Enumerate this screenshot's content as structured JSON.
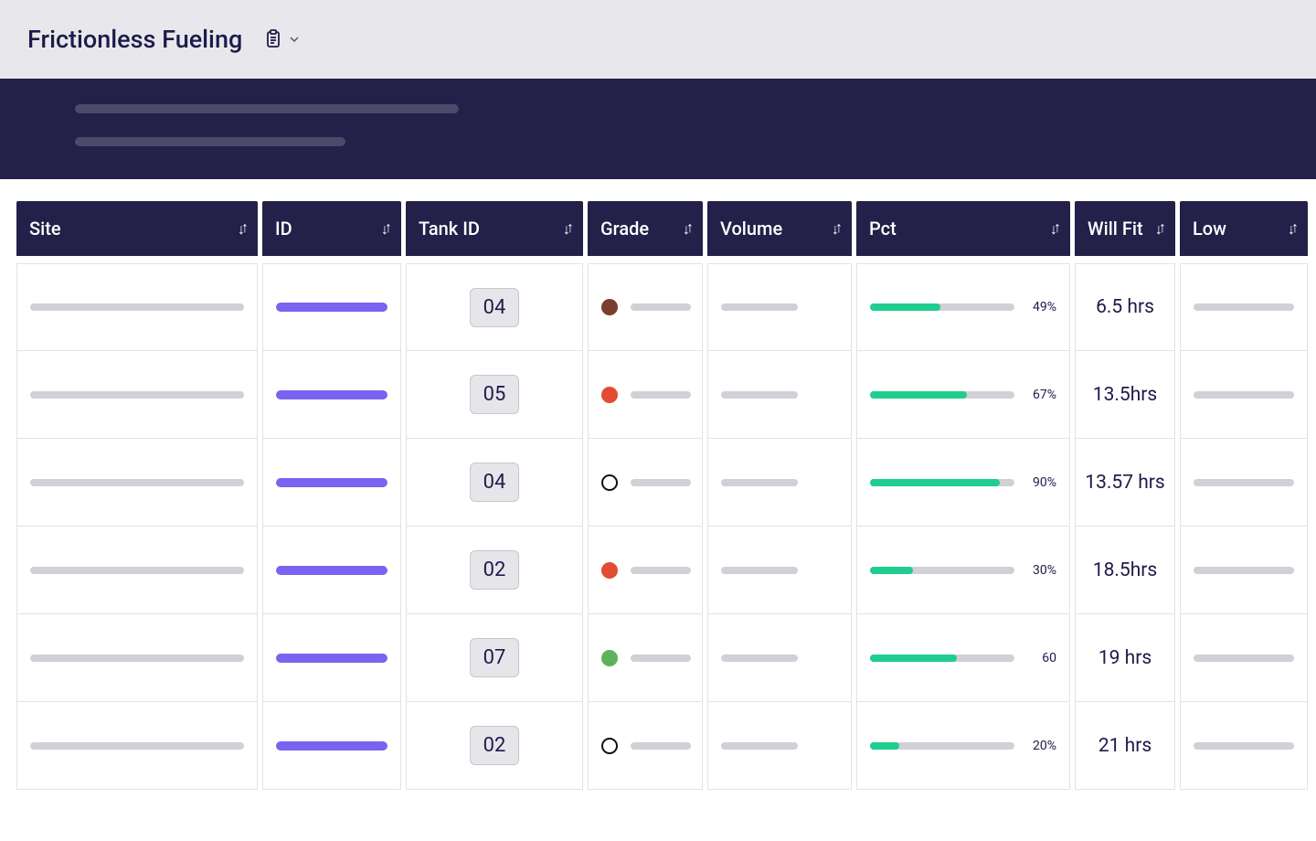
{
  "header": {
    "title": "Frictionless Fueling"
  },
  "table": {
    "columns": [
      {
        "key": "site",
        "label": "Site"
      },
      {
        "key": "id",
        "label": "ID"
      },
      {
        "key": "tank",
        "label": "Tank ID"
      },
      {
        "key": "grade",
        "label": "Grade"
      },
      {
        "key": "volume",
        "label": "Volume"
      },
      {
        "key": "pct",
        "label": "Pct"
      },
      {
        "key": "fit",
        "label": "Will Fit"
      },
      {
        "key": "low",
        "label": "Low"
      }
    ],
    "rows": [
      {
        "tank_id": "04",
        "grade_color": "brown",
        "pct": 49,
        "pct_label": "49%",
        "will_fit": "6.5 hrs"
      },
      {
        "tank_id": "05",
        "grade_color": "orange",
        "pct": 67,
        "pct_label": "67%",
        "will_fit": "13.5hrs"
      },
      {
        "tank_id": "04",
        "grade_color": "hollow",
        "pct": 90,
        "pct_label": "90%",
        "will_fit": "13.57 hrs"
      },
      {
        "tank_id": "02",
        "grade_color": "orange",
        "pct": 30,
        "pct_label": "30%",
        "will_fit": "18.5hrs"
      },
      {
        "tank_id": "07",
        "grade_color": "green",
        "pct": 60,
        "pct_label": "60",
        "will_fit": "19 hrs"
      },
      {
        "tank_id": "02",
        "grade_color": "hollow",
        "pct": 20,
        "pct_label": "20%",
        "will_fit": "21 hrs"
      }
    ]
  },
  "colors": {
    "header_bg": "#232049",
    "accent_purple": "#7b62f0",
    "progress_green": "#1fce8f"
  }
}
